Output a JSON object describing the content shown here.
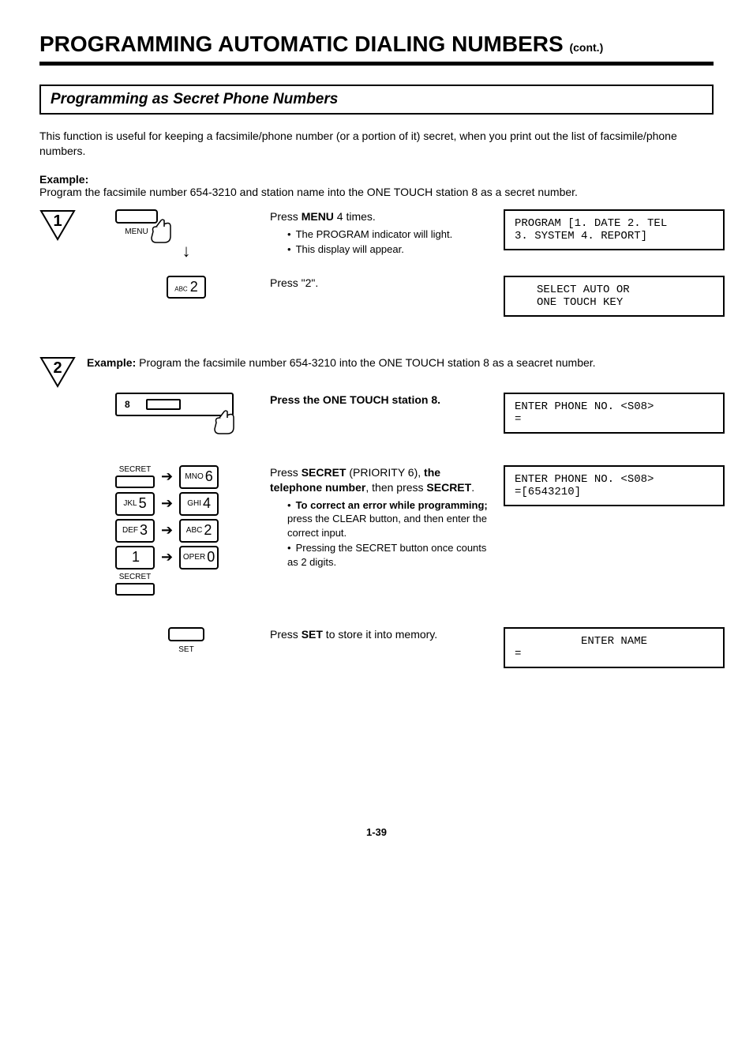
{
  "header": {
    "title": "PROGRAMMING AUTOMATIC DIALING NUMBERS",
    "cont": "(cont.)"
  },
  "section": {
    "title": "Programming as Secret Phone Numbers"
  },
  "intro": "This function is useful for keeping a facsimile/phone number (or a portion of it) secret, when you print out the list of facsimile/phone numbers.",
  "example": {
    "label": "Example:",
    "text": "Program the facsimile number 654-3210 and station name into the ONE TOUCH station 8 as a secret number."
  },
  "step1": {
    "num": "1",
    "menu_btn": "MENU",
    "instr_prefix": "Press ",
    "instr_bold": "MENU",
    "instr_suffix": " 4 times.",
    "bullets": [
      "The PROGRAM indicator will light.",
      "This display will appear."
    ],
    "lcd": "PROGRAM [1. DATE 2. TEL\n3. SYSTEM 4. REPORT]"
  },
  "step1b": {
    "key_sub": "ABC",
    "key_big": "2",
    "instr": "Press \"2\".",
    "lcd": "SELECT AUTO OR\nONE TOUCH KEY"
  },
  "step2": {
    "num": "2",
    "ex_label": "Example:",
    "ex_text": "Program the facsimile number 654-3210 into the ONE TOUCH station 8 as a seacret number.",
    "instr": "Press the ONE TOUCH station 8.",
    "onetouch_num": "8",
    "lcd": "ENTER PHONE NO. <S08>\n="
  },
  "step2b": {
    "secret_label": "SECRET",
    "keys": [
      {
        "sub": "MNO",
        "big": "6"
      },
      {
        "sub": "JKL",
        "big": "5"
      },
      {
        "sub": "GHI",
        "big": "4"
      },
      {
        "sub": "DEF",
        "big": "3"
      },
      {
        "sub": "ABC",
        "big": "2"
      },
      {
        "sub": "",
        "big": "1"
      },
      {
        "sub": "OPER",
        "big": "0"
      }
    ],
    "instr_p1a": "Press ",
    "instr_p1b": "SECRET",
    "instr_p1c": " (PRIORITY 6), ",
    "instr_p1d": "the telephone number",
    "instr_p1e": ", then press ",
    "instr_p1f": "SECRET",
    "instr_p1g": ".",
    "bullet1_bold": "To correct an error while programming;",
    "bullet1_rest": " press the CLEAR button, and then enter the correct input.",
    "bullet2": "Pressing the SECRET button once counts as 2 digits.",
    "lcd": "ENTER PHONE NO. <S08>\n=[6543210]"
  },
  "step2c": {
    "set_label": "SET",
    "instr_a": "Press ",
    "instr_b": "SET",
    "instr_c": " to store it into memory.",
    "lcd_line1": "ENTER NAME",
    "lcd_line2": "="
  },
  "footer": {
    "page": "1-39"
  }
}
